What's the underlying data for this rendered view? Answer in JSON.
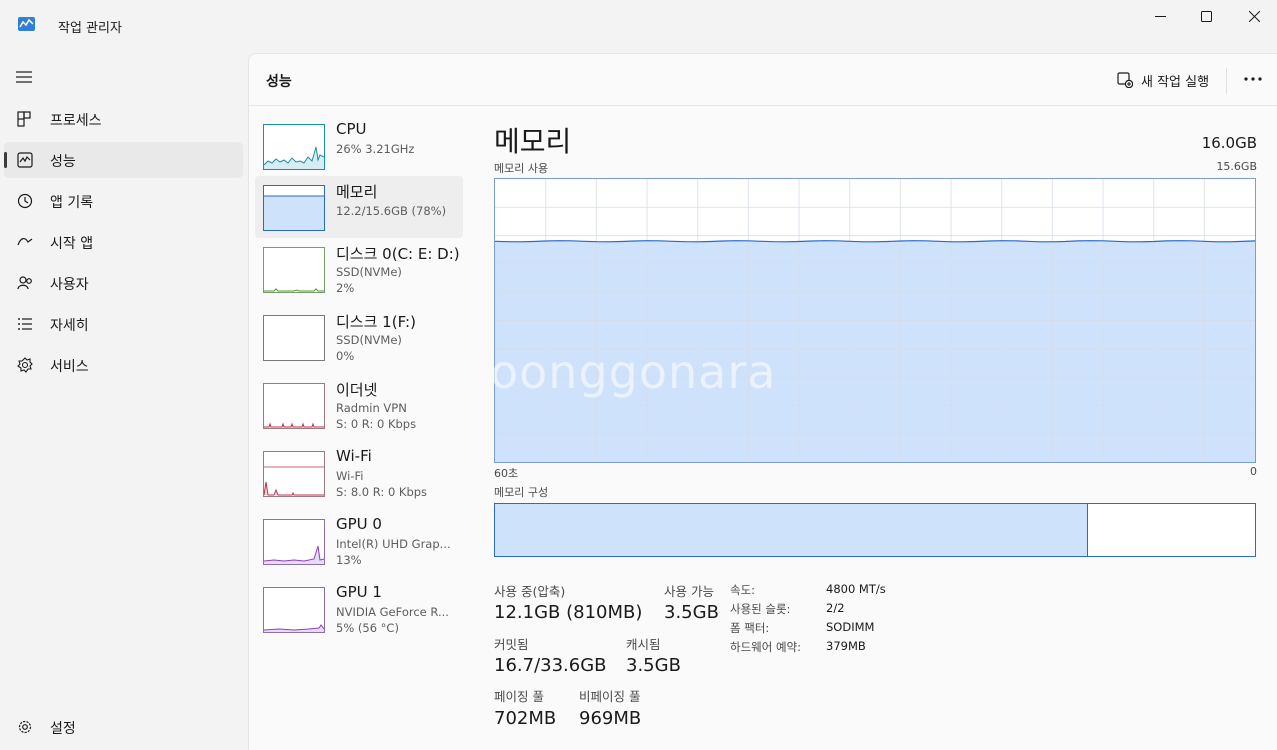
{
  "window": {
    "title": "작업 관리자",
    "minimize_icon": "minimize-icon",
    "maximize_icon": "maximize-icon",
    "close_icon": "close-icon"
  },
  "sidebar": {
    "items": [
      {
        "label": "프로세스",
        "icon": "processes-icon"
      },
      {
        "label": "성능",
        "icon": "performance-icon",
        "active": true
      },
      {
        "label": "앱 기록",
        "icon": "app-history-icon"
      },
      {
        "label": "시작 앱",
        "icon": "startup-apps-icon"
      },
      {
        "label": "사용자",
        "icon": "users-icon"
      },
      {
        "label": "자세히",
        "icon": "details-icon"
      },
      {
        "label": "서비스",
        "icon": "services-icon"
      }
    ],
    "settings_label": "설정"
  },
  "header": {
    "title": "성능",
    "run_task_label": "새 작업 실행"
  },
  "devices": [
    {
      "name": "CPU",
      "lines": [
        "26% 3.21GHz"
      ]
    },
    {
      "name": "메모리",
      "lines": [
        "12.2/15.6GB (78%)"
      ],
      "active": true
    },
    {
      "name": "디스크 0(C: E: D:)",
      "lines": [
        "SSD(NVMe)",
        "2%"
      ]
    },
    {
      "name": "디스크 1(F:)",
      "lines": [
        "SSD(NVMe)",
        "0%"
      ]
    },
    {
      "name": "이더넷",
      "lines": [
        "Radmin VPN",
        "S: 0 R: 0 Kbps"
      ]
    },
    {
      "name": "Wi-Fi",
      "lines": [
        "Wi-Fi",
        "S: 8.0 R: 0 Kbps"
      ]
    },
    {
      "name": "GPU 0",
      "lines": [
        "Intel(R) UHD Grap...",
        "13%"
      ]
    },
    {
      "name": "GPU 1",
      "lines": [
        "NVIDIA GeForce R...",
        "5% (56 °C)"
      ]
    }
  ],
  "detail": {
    "title": "메모리",
    "total": "16.0GB",
    "usage_label": "메모리 사용",
    "usage_max": "15.6GB",
    "axis_left": "60초",
    "axis_right": "0",
    "usage_fraction": 0.78,
    "composition_label": "메모리 구성",
    "composition_used_fraction": 0.78,
    "stats": {
      "in_use_label": "사용 중(압축)",
      "in_use_value": "12.1GB (810MB)",
      "available_label": "사용 가능",
      "available_value": "3.5GB",
      "committed_label": "커밋됨",
      "committed_value": "16.7/33.6GB",
      "cached_label": "캐시됨",
      "cached_value": "3.5GB",
      "paged_label": "페이징 풀",
      "paged_value": "702MB",
      "nonpaged_label": "비페이징 풀",
      "nonpaged_value": "969MB"
    },
    "specs": [
      {
        "key": "속도:",
        "value": "4800 MT/s"
      },
      {
        "key": "사용된 슬롯:",
        "value": "2/2"
      },
      {
        "key": "폼 팩터:",
        "value": "SODIMM"
      },
      {
        "key": "하드웨어 예약:",
        "value": "379MB"
      }
    ]
  },
  "watermark": "oonggonara",
  "colors": {
    "memory_fill": "#cfe2fb",
    "memory_line": "#2a6bc6",
    "cpu_line": "#1a8fa8",
    "disk_line": "#4c9a2a",
    "network_line": "#c0304a",
    "gpu_line": "#8b3fc9"
  }
}
